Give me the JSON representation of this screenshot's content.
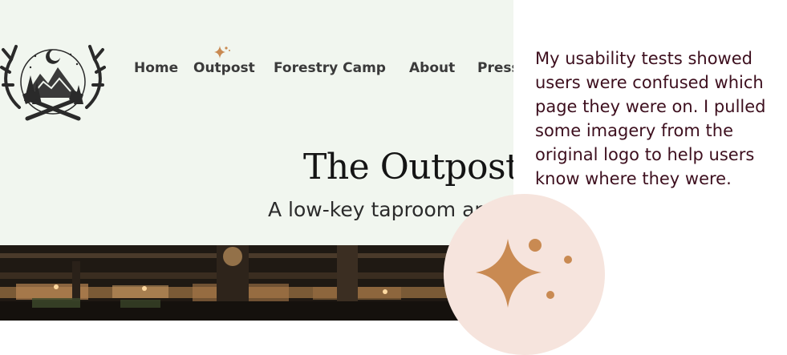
{
  "nav": {
    "items": [
      {
        "label": "Home"
      },
      {
        "label": "Outpost"
      },
      {
        "label": "Forestry Camp"
      },
      {
        "label": "About"
      },
      {
        "label": "Press"
      }
    ],
    "active": "Outpost"
  },
  "page": {
    "title": "The Outpost",
    "subtitle": "A low-key taproom and"
  },
  "annotation": {
    "text": "My usability tests showed users were confused which page they were on. I pulled some imagery from the original logo to help users know where they were."
  },
  "colors": {
    "site_background": "#f1f6ef",
    "sparkle": "#c98a52",
    "badge_background": "#f6e4dd",
    "annotation_text": "#3d0f1e"
  },
  "icons": {
    "logo": "mountain-antlers-axes-logo",
    "active_indicator": "sparkle-icon"
  }
}
